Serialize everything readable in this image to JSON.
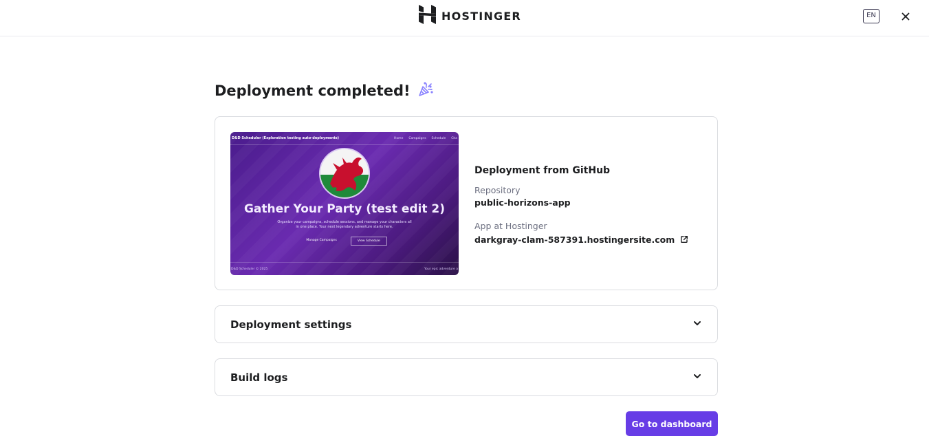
{
  "header": {
    "brand_name": "HOSTINGER",
    "language": "EN"
  },
  "page": {
    "title": "Deployment completed!"
  },
  "preview": {
    "nav_title": "D&D Scheduler (Exploration testing auto-deployments)",
    "nav_links": [
      "Home",
      "Campaigns",
      "Schedule",
      "Cha"
    ],
    "heading": "Gather Your Party (test edit 2)",
    "subtext": "Organize your campaigns, schedule sessions, and manage your characters all in one place. Your next legendary adventure starts here.",
    "button_primary": "Manage Campaigns",
    "button_secondary": "View Schedule",
    "footer_left": "D&D Scheduler © 2025",
    "footer_right": "Your epic adventure a"
  },
  "deployment": {
    "heading": "Deployment from GitHub",
    "repository_label": "Repository",
    "repository_value": "public-horizons-app",
    "app_label": "App at Hostinger",
    "app_url": "darkgray-clam-587391.hostingersite.com"
  },
  "sections": {
    "settings_title": "Deployment settings",
    "logs_title": "Build logs"
  },
  "actions": {
    "dashboard_button": "Go to dashboard"
  },
  "colors": {
    "accent": "#673de6",
    "icon_purple": "#8c85ff"
  }
}
